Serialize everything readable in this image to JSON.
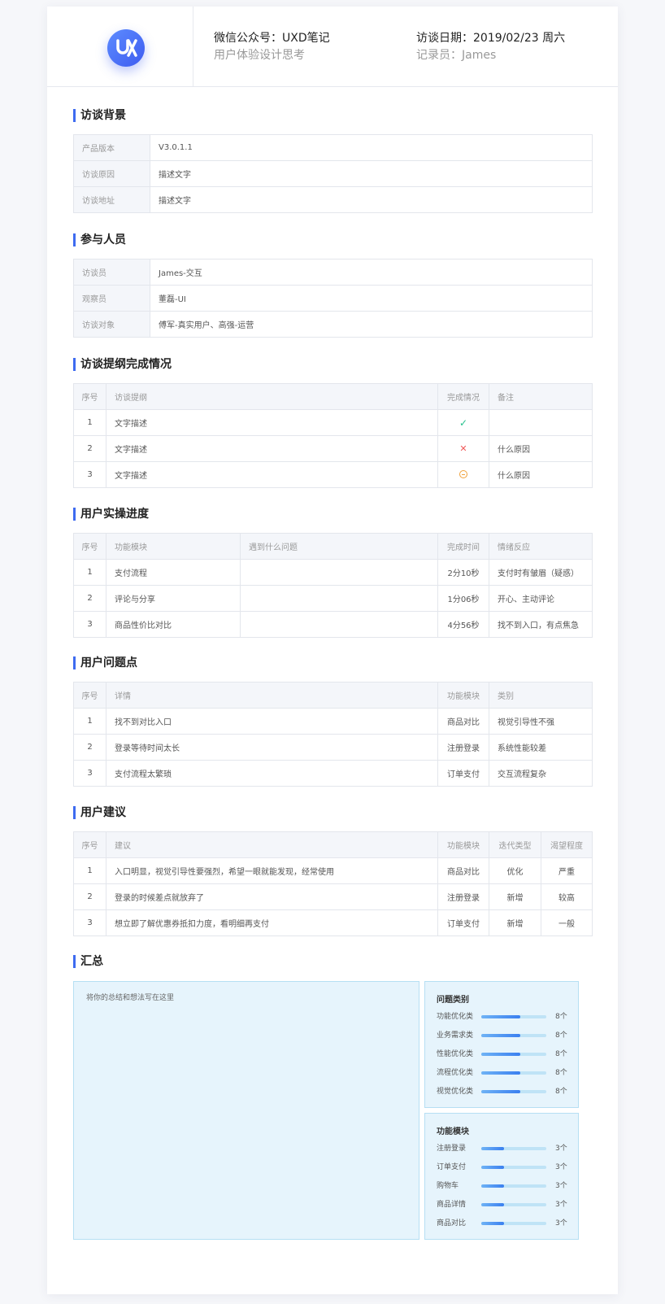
{
  "header": {
    "account": "微信公众号：UXD笔记",
    "account_sub": "用户体验设计思考",
    "date": "访谈日期：2019/02/23 周六",
    "recorder": "记录员：James"
  },
  "background": {
    "title": "访谈背景",
    "rows": [
      {
        "key": "产品版本",
        "value": "V3.0.1.1"
      },
      {
        "key": "访谈原因",
        "value": "描述文字"
      },
      {
        "key": "访谈地址",
        "value": "描述文字"
      }
    ]
  },
  "participants": {
    "title": "参与人员",
    "rows": [
      {
        "key": "访谈员",
        "value": "James-交互"
      },
      {
        "key": "观察员",
        "value": "董磊-UI"
      },
      {
        "key": "访谈对象",
        "value": "傅军-真实用户、高强-运营"
      }
    ]
  },
  "outline": {
    "title": "访谈提纲完成情况",
    "headers": [
      "序号",
      "访谈提纲",
      "完成情况",
      "备注"
    ],
    "rows": [
      {
        "no": "1",
        "item": "文字描述",
        "status": "done",
        "note": ""
      },
      {
        "no": "2",
        "item": "文字描述",
        "status": "failed",
        "note": "什么原因"
      },
      {
        "no": "3",
        "item": "文字描述",
        "status": "partial",
        "note": "什么原因"
      }
    ]
  },
  "progress": {
    "title": "用户实操进度",
    "headers": [
      "序号",
      "功能模块",
      "遇到什么问题",
      "完成时间",
      "情绪反应"
    ],
    "rows": [
      {
        "no": "1",
        "module": "支付流程",
        "problem": "",
        "time": "2分10秒",
        "emotion": "支付时有皱眉（疑惑）"
      },
      {
        "no": "2",
        "module": "评论与分享",
        "problem": "",
        "time": "1分06秒",
        "emotion": "开心、主动评论"
      },
      {
        "no": "3",
        "module": "商品性价比对比",
        "problem": "",
        "time": "4分56秒",
        "emotion": "找不到入口，有点焦急"
      }
    ]
  },
  "issues": {
    "title": "用户问题点",
    "headers": [
      "序号",
      "详情",
      "功能模块",
      "类别"
    ],
    "rows": [
      {
        "no": "1",
        "detail": "找不到对比入口",
        "module": "商品对比",
        "category": "视觉引导性不强"
      },
      {
        "no": "2",
        "detail": "登录等待时间太长",
        "module": "注册登录",
        "category": "系统性能较差"
      },
      {
        "no": "3",
        "detail": "支付流程太繁琐",
        "module": "订单支付",
        "category": "交互流程复杂"
      }
    ]
  },
  "suggestions": {
    "title": "用户建议",
    "headers": [
      "序号",
      "建议",
      "功能模块",
      "迭代类型",
      "渴望程度"
    ],
    "rows": [
      {
        "no": "1",
        "text": "入口明显，视觉引导性要强烈，希望一眼就能发现，经常使用",
        "module": "商品对比",
        "type": "优化",
        "level": "严重"
      },
      {
        "no": "2",
        "text": "登录的时候差点就放弃了",
        "module": "注册登录",
        "type": "新增",
        "level": "较高"
      },
      {
        "no": "3",
        "text": "想立即了解优惠券抵扣力度，看明细再支付",
        "module": "订单支付",
        "type": "新增",
        "level": "一般"
      }
    ]
  },
  "summary": {
    "title": "汇总",
    "placeholder": "将你的总结和想法写在这里",
    "issue_types": {
      "title": "问题类别",
      "items": [
        {
          "label": "功能优化类",
          "count": "8个",
          "fill": 0.6
        },
        {
          "label": "业务需求类",
          "count": "8个",
          "fill": 0.6
        },
        {
          "label": "性能优化类",
          "count": "8个",
          "fill": 0.6
        },
        {
          "label": "流程优化类",
          "count": "8个",
          "fill": 0.6
        },
        {
          "label": "视觉优化类",
          "count": "8个",
          "fill": 0.6
        }
      ]
    },
    "modules": {
      "title": "功能模块",
      "items": [
        {
          "label": "注册登录",
          "count": "3个",
          "fill": 0.35
        },
        {
          "label": "订单支付",
          "count": "3个",
          "fill": 0.35
        },
        {
          "label": "购物车",
          "count": "3个",
          "fill": 0.35
        },
        {
          "label": "商品详情",
          "count": "3个",
          "fill": 0.35
        },
        {
          "label": "商品对比",
          "count": "3个",
          "fill": 0.35
        }
      ]
    }
  },
  "colors": {
    "accent": "#3e6bf0",
    "success": "#27c18d",
    "error": "#f05a5a",
    "warning": "#f0a13a"
  }
}
